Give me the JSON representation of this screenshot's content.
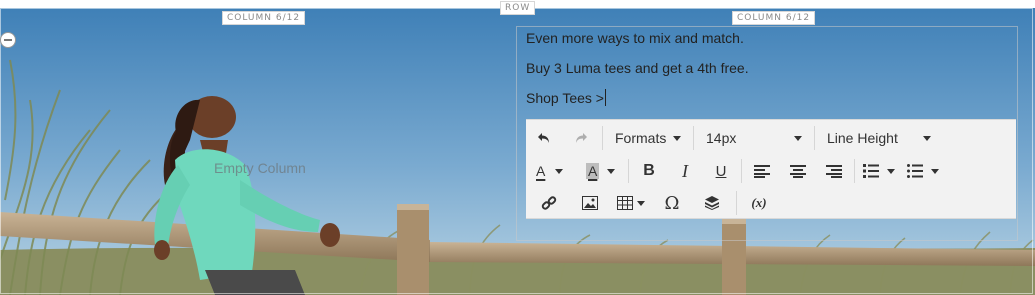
{
  "labels": {
    "row": "ROW",
    "column_left": "COLUMN 6/12",
    "column_right": "COLUMN 6/12",
    "empty_column": "Empty Column"
  },
  "editor": {
    "lines": [
      "Even more ways to mix and match.",
      "Buy 3 Luma tees and get a 4th free.",
      "Shop Tees >"
    ]
  },
  "toolbar": {
    "formats_label": "Formats",
    "font_size_value": "14px",
    "line_height_label": "Line Height",
    "font_color_label": "A",
    "bg_color_label": "A",
    "bold_label": "B",
    "italic_label": "I",
    "underline_label": "U",
    "special_char_label": "Ω",
    "variable_label": "(x)"
  },
  "colors": {
    "sky_top": "#3f80b7",
    "sky_bottom": "#b9d4e4",
    "shirt": "#6fd8bd",
    "fence": "#b79f7f",
    "toolbar_bg": "#f2f2f2"
  },
  "icons": [
    "undo-icon",
    "redo-icon",
    "align-left-icon",
    "align-center-icon",
    "align-right-icon",
    "numbered-list-icon",
    "bullet-list-icon",
    "link-icon",
    "image-icon",
    "table-icon",
    "widget-icon"
  ]
}
